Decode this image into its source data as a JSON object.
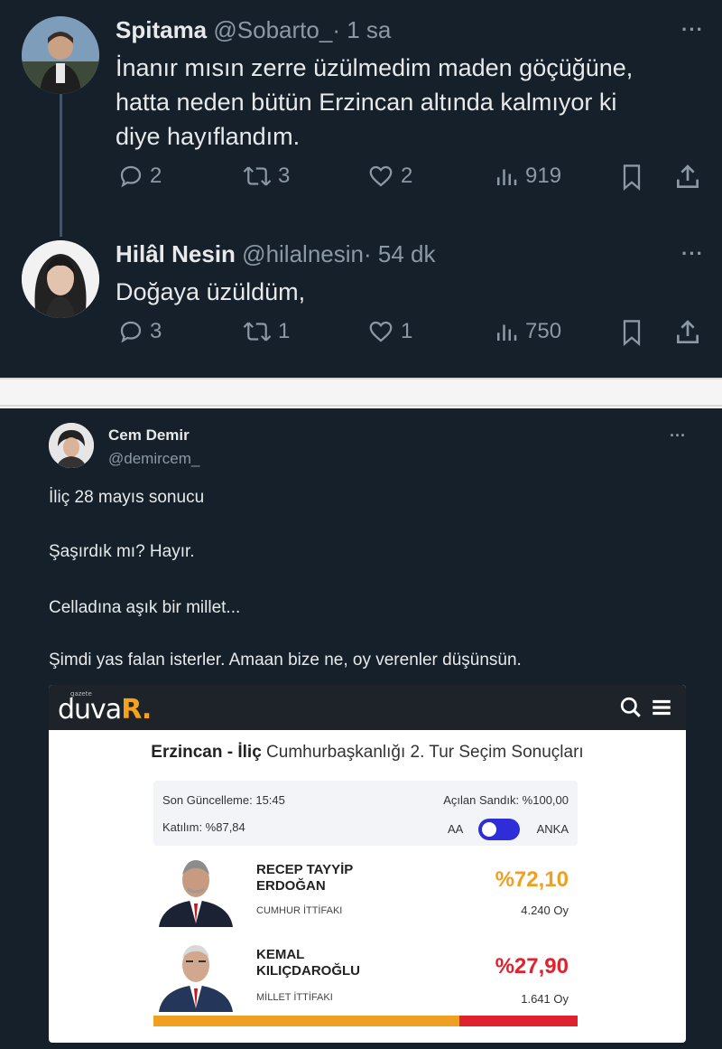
{
  "tweets": [
    {
      "name": "Spitama",
      "handle": "@Sobarto_",
      "time": "· 1 sa",
      "lines": [
        "İnanır mısın zerre üzülmedim maden göçüğüne,",
        "hatta neden bütün Erzincan altında kalmıyor ki",
        "diye hayıflandım."
      ],
      "replies": "2",
      "retweets": "3",
      "likes": "2",
      "views": "919"
    },
    {
      "name": "Hilâl Nesin",
      "handle": "@hilalnesin",
      "time": "· 54 dk",
      "lines": [
        "Doğaya üzüldüm,"
      ],
      "replies": "3",
      "retweets": "1",
      "likes": "1",
      "views": "750"
    }
  ],
  "more_label": "···",
  "post": {
    "name": "Cem Demir",
    "handle": "@demircem_",
    "lines": [
      "İliç 28 mayıs sonucu",
      "Şaşırdık mı? Hayır.",
      "Celladına aşık bir millet...",
      "Şimdi yas falan isterler. Amaan bize ne, oy verenler düşünsün."
    ]
  },
  "card": {
    "logo_small": "gazete",
    "logo_main": "duva",
    "logo_accent": "R.",
    "title_bold": "Erzincan - İliç",
    "title_rest": "Cumhurbaşkanlığı 2. Tur Seçim Sonuçları",
    "updated": "Son Güncelleme: 15:45",
    "opened": "Açılan Sandık: %100,00",
    "turnout": "Katılım: %87,84",
    "source_left": "AA",
    "source_right": "ANKA",
    "candidates": [
      {
        "name_line1": "RECEP TAYYİP",
        "name_line2": "ERDOĞAN",
        "party": "CUMHUR İTTİFAKI",
        "pct": "%72,10",
        "votes": "4.240 Oy",
        "color": "#f0a020"
      },
      {
        "name_line1": "KEMAL",
        "name_line2": "KILIÇDAROĞLU",
        "party": "MİLLET İTTİFAKI",
        "pct": "%27,90",
        "votes": "1.641 Oy",
        "color": "#e0222e"
      }
    ],
    "bar_shares": [
      0.721,
      0.279
    ]
  }
}
